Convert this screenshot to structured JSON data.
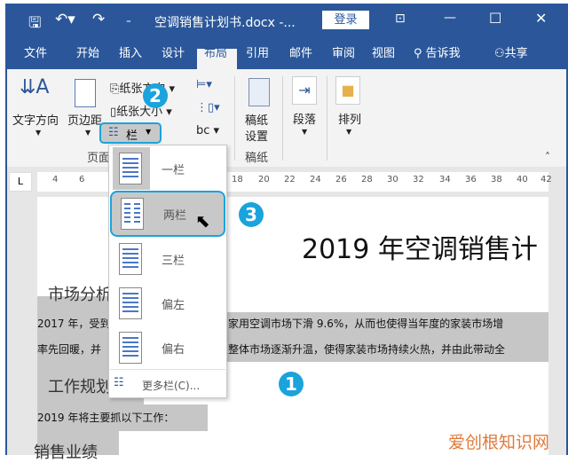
{
  "titlebar": {
    "title": "空调销售计划书.docx -...",
    "login": "登录",
    "icons": [
      "save-icon",
      "undo-icon",
      "redo-icon",
      "customize-icon",
      "ribbon-display-icon",
      "minimize-icon",
      "maximize-icon",
      "close-icon"
    ]
  },
  "tabs": [
    "文件",
    "开始",
    "插入",
    "设计",
    "布局",
    "引用",
    "邮件",
    "审阅",
    "视图"
  ],
  "active_tab": "布局",
  "tell_me": "告诉我",
  "share": "共享",
  "ribbon": {
    "text_direction": "文字方向",
    "margins": "页边距",
    "orientation": "纸张方向",
    "size": "纸张大小",
    "columns": "栏",
    "hyphen": "bc",
    "manuscript_setup": [
      "稿纸",
      "设置"
    ],
    "paragraph": "段落",
    "arrange": "排列",
    "group_page": "页面",
    "group_manuscript": "稿纸"
  },
  "ruler": {
    "left_marker": "L",
    "numbers": [
      "4",
      "6",
      "18",
      "20",
      "22",
      "24",
      "26",
      "28",
      "30",
      "32",
      "34",
      "36",
      "38",
      "40",
      "42"
    ]
  },
  "menu": {
    "items": [
      "一栏",
      "两栏",
      "三栏",
      "偏左",
      "偏右"
    ],
    "more": "更多栏(C)...",
    "selected": "两栏"
  },
  "badges": [
    "1",
    "2",
    "3"
  ],
  "accent": "#1aa3dc",
  "document": {
    "title": "2019 年空调销售计",
    "h1": "市场分析",
    "p1": "2017 年，受到",
    "p1b": "家用空调市场下滑 9.6%，从而也使得当年度的家装市场增",
    "p2": "率先回暖，并",
    "p2b": "整体市场逐渐升温，使得家装市场持续火热，并由此带动全",
    "h2": "工作规划",
    "p3": "2019 年将主要抓以下工作：",
    "h3": "销售业绩"
  },
  "watermark": "爱创根知识网"
}
